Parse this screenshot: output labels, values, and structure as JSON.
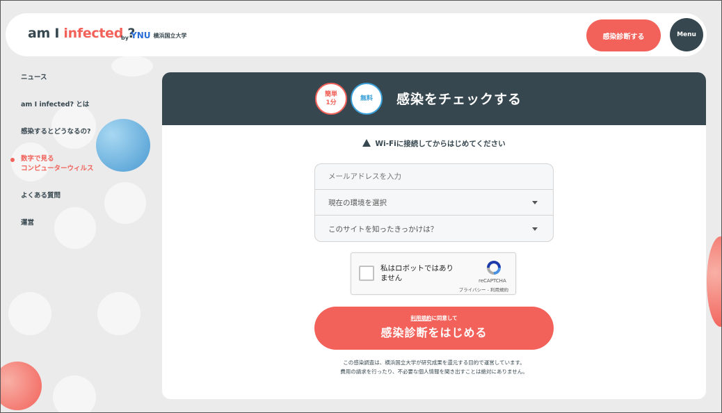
{
  "header": {
    "logo_am": "am I ",
    "logo_infected": "infected",
    "logo_q": " ?",
    "logo_by": "by",
    "logo_ynu": "YNU",
    "logo_univ": "横浜国立大学",
    "diagnose_button": "感染診断する",
    "menu_button": "Menu"
  },
  "sidebar": {
    "items": [
      {
        "label": "ニュース"
      },
      {
        "label": "am I infected? とは"
      },
      {
        "label": "感染するとどうなるの?"
      },
      {
        "label_line1": "数字で見る",
        "label_line2": "コンピューターウィルス"
      },
      {
        "label": "よくある質問"
      },
      {
        "label": "運営"
      }
    ]
  },
  "card": {
    "badge_quick_line1": "簡単",
    "badge_quick_line2": "1分",
    "badge_free": "無料",
    "title": "感染をチェックする",
    "notice": "Wi-Fiに接続してからはじめてください",
    "email_placeholder": "メールアドレスを入力",
    "env_select": "現在の環境を選択",
    "source_select": "このサイトを知ったきっかけは？",
    "captcha": {
      "label_line1": "私はロボットではあり",
      "label_line2": "ません",
      "brand": "reCAPTCHA",
      "links": "プライバシー - 利用規約"
    },
    "start": {
      "terms_link": "利用規約",
      "agree_text": "に同意して",
      "label": "感染診断をはじめる"
    },
    "footer_line1": "この感染調査は、横浜国立大学が研究成果を還元する目的で運営しています。",
    "footer_line2": "費用の請求を行ったり、不必要な個人情報を聞き出すことは絶対にありません。"
  },
  "colors": {
    "accent": "#f2625a",
    "dark": "#37474f",
    "blue": "#3aa0d8"
  }
}
